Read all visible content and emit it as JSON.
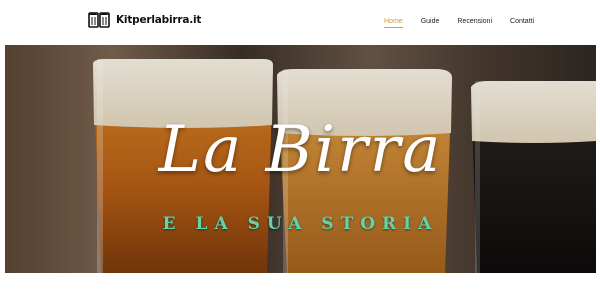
{
  "header": {
    "logo_text": "Kitperlabirra.it",
    "nav": [
      {
        "label": "Home",
        "active": true
      },
      {
        "label": "Guide",
        "active": false
      },
      {
        "label": "Recensioni",
        "active": false
      },
      {
        "label": "Contatti",
        "active": false
      }
    ]
  },
  "hero": {
    "title": "La Birra",
    "subtitle": "E LA SUA STORIA"
  },
  "colors": {
    "accent": "#d49a2a",
    "subtitle": "#5fd4ad"
  },
  "icons": {
    "logo": "beer-mugs-icon"
  }
}
